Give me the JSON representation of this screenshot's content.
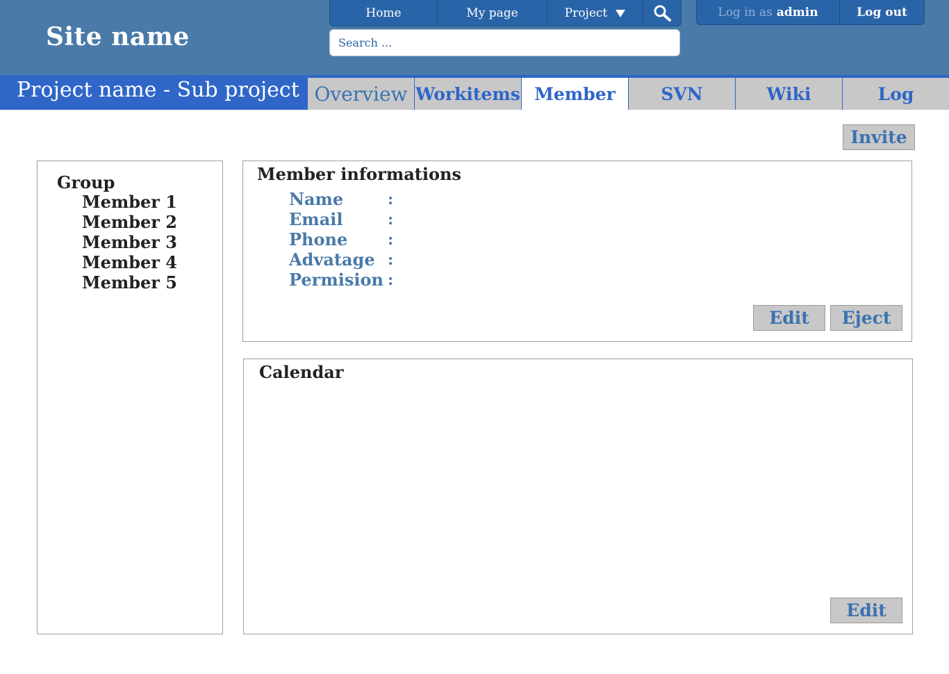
{
  "header": {
    "site_name": "Site name",
    "nav": {
      "home": "Home",
      "my_page": "My page",
      "project": "Project"
    },
    "search_placeholder": "Search ...",
    "user": {
      "login_prefix": "Log in as",
      "username": "admin",
      "logout": "Log out"
    }
  },
  "project": {
    "title": "Project name - Sub project",
    "tabs": [
      {
        "label": "Overview"
      },
      {
        "label": "Workitems"
      },
      {
        "label": "Member"
      },
      {
        "label": "SVN"
      },
      {
        "label": "Wiki"
      },
      {
        "label": "Log"
      }
    ],
    "active_tab": "Member"
  },
  "actions": {
    "invite": "Invite"
  },
  "group": {
    "title": "Group",
    "members": [
      "Member 1",
      "Member 2",
      "Member 3",
      "Member 4",
      "Member 5"
    ]
  },
  "member_info": {
    "title": "Member informations",
    "fields": [
      {
        "label": "Name",
        "value": ""
      },
      {
        "label": "Email",
        "value": ""
      },
      {
        "label": "Phone",
        "value": ""
      },
      {
        "label": "Advatage",
        "value": ""
      },
      {
        "label": "Permision",
        "value": ""
      }
    ],
    "edit": "Edit",
    "eject": "Eject"
  },
  "calendar": {
    "title": "Calendar",
    "edit": "Edit"
  },
  "colors": {
    "header_bg": "#4a7aa8",
    "nav_bg": "#2a64a8",
    "project_bar": "#2f66c8",
    "tab_bg": "#c8c8c8",
    "label_blue": "#4a7aa8"
  }
}
